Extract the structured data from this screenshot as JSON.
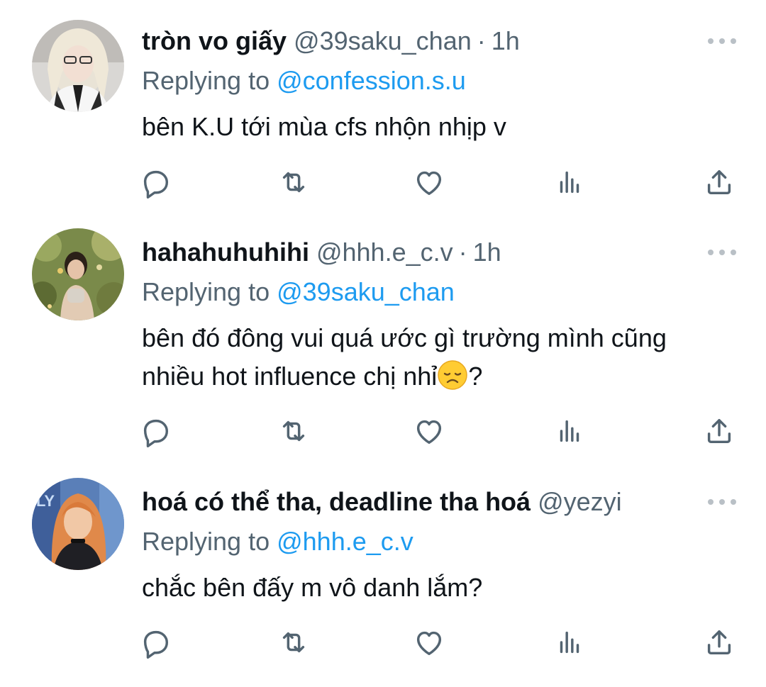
{
  "tweets": [
    {
      "display_name": "tròn vo giấy",
      "handle": "@39saku_chan",
      "separator": "·",
      "time": "1h",
      "replying_prefix": "Replying to",
      "replying_to": "@confession.s.u",
      "text": "bên K.U tới mùa cfs nhộn nhịp v",
      "avatar_icon": "avatar-icon"
    },
    {
      "display_name": "hahahuhuhihi",
      "handle": "@hhh.e_c.v",
      "separator": "·",
      "time": "1h",
      "replying_prefix": "Replying to",
      "replying_to": "@39saku_chan",
      "text_line1": "bên đó đông vui quá ước gì trường mình cũng",
      "text_line2": "nhiều hot influence chị nhỉ",
      "text_emoji": "disappointed-face-emoji",
      "text_end": "?",
      "avatar_icon": "avatar-icon"
    },
    {
      "display_name": "hoá có thể tha, deadline tha hoá",
      "handle": "@yezyi",
      "replying_prefix": "Replying to",
      "replying_to": "@hhh.e_c.v",
      "text": "chắc bên đấy m vô danh lắm?",
      "avatar_icon": "avatar-icon"
    }
  ],
  "actions": [
    "reply-icon",
    "retweet-icon",
    "like-icon",
    "views-icon",
    "share-icon"
  ],
  "colors": {
    "text": "#0f1419",
    "secondary": "#536471",
    "link": "#1d9bf0",
    "icon": "#536471",
    "more_dots": "#b9c0c6"
  }
}
